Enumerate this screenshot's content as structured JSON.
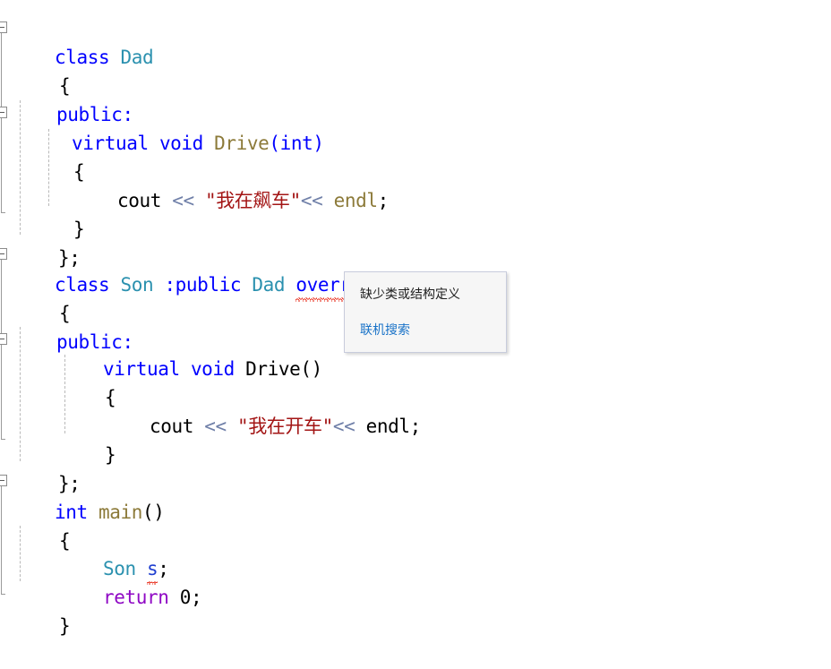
{
  "app": {
    "kind": "code-editor",
    "language": "C++",
    "background": "#ffffff"
  },
  "colors": {
    "keyword": "#0000ff",
    "type": "#2b91af",
    "function": "#8c7a39",
    "string": "#a31515",
    "operator": "#6f7fa8",
    "control_keyword": "#8f08c4",
    "plain": "#000000",
    "error_squiggle": "#e51400",
    "tooltip_background": "#f6f6f6",
    "tooltip_border": "#c8ccdc",
    "link": "#1a73c8",
    "indent_guide": "#b9b9b9",
    "fold_marker": "#8b8b8b"
  },
  "code": {
    "lines": [
      {
        "indent": 0,
        "text": "class Dad"
      },
      {
        "indent": 0,
        "text": "{"
      },
      {
        "indent": 0,
        "text": "public:"
      },
      {
        "indent": 1,
        "text": "virtual void Drive(int)"
      },
      {
        "indent": 1,
        "text": "{"
      },
      {
        "indent": 2,
        "text": "cout << \"我在飙车\" << endl;"
      },
      {
        "indent": 1,
        "text": "}"
      },
      {
        "indent": 0,
        "text": "};"
      },
      {
        "indent": 0,
        "text": "class Son :public Dad override"
      },
      {
        "indent": 0,
        "text": "{"
      },
      {
        "indent": 0,
        "text": "public:"
      },
      {
        "indent": 1,
        "text": "virtual void Drive()"
      },
      {
        "indent": 1,
        "text": "{"
      },
      {
        "indent": 2,
        "text": "cout << \"我在开车\" << endl;"
      },
      {
        "indent": 1,
        "text": "}"
      },
      {
        "indent": 0,
        "text": "};"
      },
      {
        "indent": 0,
        "text": "int main()"
      },
      {
        "indent": 0,
        "text": "{"
      },
      {
        "indent": 1,
        "text": "Son s;"
      },
      {
        "indent": 1,
        "text": "return 0;"
      },
      {
        "indent": 0,
        "text": "}"
      }
    ],
    "tokens": {
      "class": "class",
      "dad": "Dad",
      "son": "Son",
      "brace_open": "{",
      "brace_close": "}",
      "brace_close_semi": "};",
      "public_label": "public:",
      "colon_public": ":public",
      "virtual": "virtual",
      "void": "void",
      "drive": "Drive",
      "paren_int": "(int)",
      "paren_empty": "()",
      "override": "override",
      "cout": "cout",
      "shift_left": "<<",
      "string_piaoche": "\"我在飙车\"",
      "string_kaiche": "\"我在开车\"",
      "endl": "endl",
      "semicolon": ";",
      "int": "int",
      "main": "main",
      "var_s": "s",
      "return": "return",
      "zero": "0"
    }
  },
  "tooltip": {
    "message": "缺少类或结构定义",
    "link": "联机搜索"
  }
}
